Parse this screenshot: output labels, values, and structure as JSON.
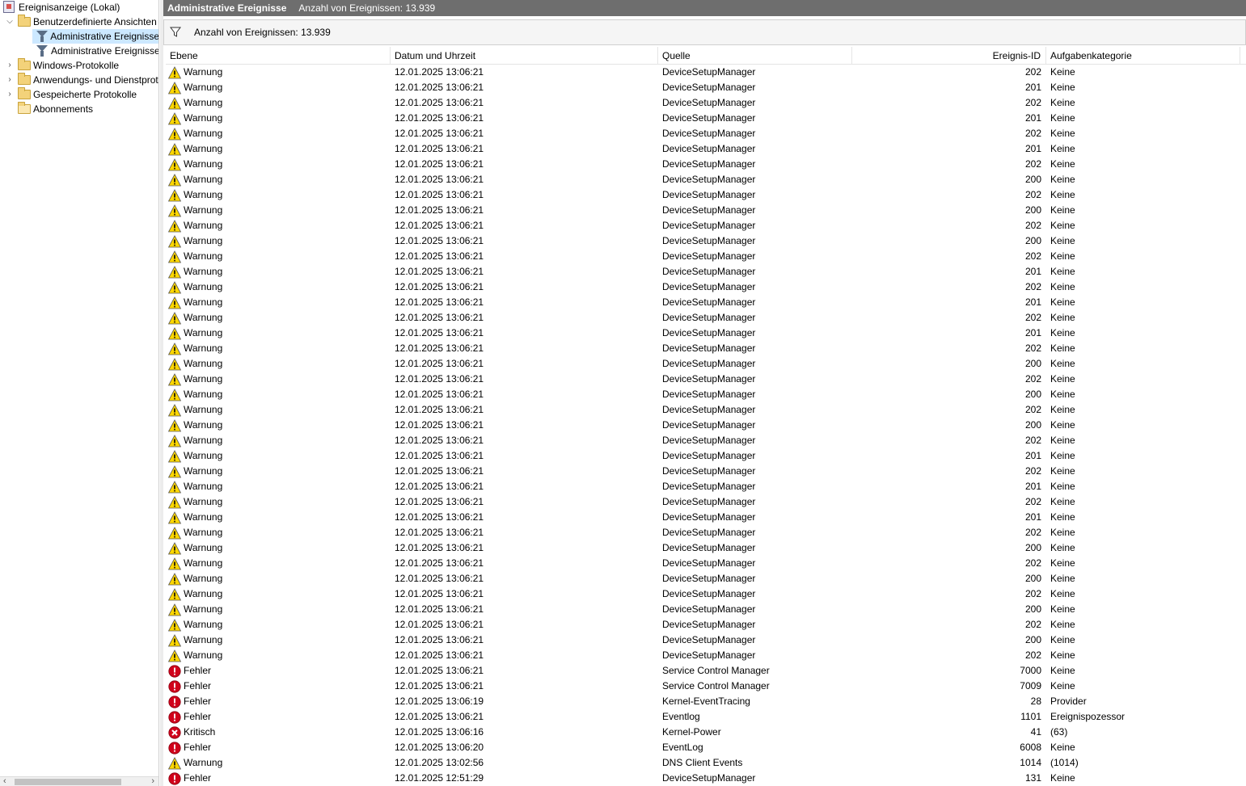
{
  "tree": {
    "root": "Ereignisanzeige (Lokal)",
    "custom_views": "Benutzerdefinierte Ansichten",
    "admin_view_1": "Administrative Ereignisse",
    "admin_view_2": "Administrative Ereignisse",
    "windows_logs": "Windows-Protokolle",
    "app_service_logs": "Anwendungs- und Dienstprotokolle",
    "saved_logs": "Gespeicherte Protokolle",
    "subscriptions": "Abonnements"
  },
  "header": {
    "title": "Administrative Ereignisse",
    "count": "Anzahl von Ereignissen: 13.939"
  },
  "filter": {
    "text": "Anzahl von Ereignissen: 13.939"
  },
  "columns": [
    "Ebene",
    "Datum und Uhrzeit",
    "Quelle",
    "Ereignis-ID",
    "Aufgabenkategorie"
  ],
  "rows": [
    {
      "level": "Warnung",
      "type": "warning",
      "date": "12.01.2025 13:06:21",
      "source": "DeviceSetupManager",
      "id": "202",
      "category": "Keine"
    },
    {
      "level": "Warnung",
      "type": "warning",
      "date": "12.01.2025 13:06:21",
      "source": "DeviceSetupManager",
      "id": "201",
      "category": "Keine"
    },
    {
      "level": "Warnung",
      "type": "warning",
      "date": "12.01.2025 13:06:21",
      "source": "DeviceSetupManager",
      "id": "202",
      "category": "Keine"
    },
    {
      "level": "Warnung",
      "type": "warning",
      "date": "12.01.2025 13:06:21",
      "source": "DeviceSetupManager",
      "id": "201",
      "category": "Keine"
    },
    {
      "level": "Warnung",
      "type": "warning",
      "date": "12.01.2025 13:06:21",
      "source": "DeviceSetupManager",
      "id": "202",
      "category": "Keine"
    },
    {
      "level": "Warnung",
      "type": "warning",
      "date": "12.01.2025 13:06:21",
      "source": "DeviceSetupManager",
      "id": "201",
      "category": "Keine"
    },
    {
      "level": "Warnung",
      "type": "warning",
      "date": "12.01.2025 13:06:21",
      "source": "DeviceSetupManager",
      "id": "202",
      "category": "Keine"
    },
    {
      "level": "Warnung",
      "type": "warning",
      "date": "12.01.2025 13:06:21",
      "source": "DeviceSetupManager",
      "id": "200",
      "category": "Keine"
    },
    {
      "level": "Warnung",
      "type": "warning",
      "date": "12.01.2025 13:06:21",
      "source": "DeviceSetupManager",
      "id": "202",
      "category": "Keine"
    },
    {
      "level": "Warnung",
      "type": "warning",
      "date": "12.01.2025 13:06:21",
      "source": "DeviceSetupManager",
      "id": "200",
      "category": "Keine"
    },
    {
      "level": "Warnung",
      "type": "warning",
      "date": "12.01.2025 13:06:21",
      "source": "DeviceSetupManager",
      "id": "202",
      "category": "Keine"
    },
    {
      "level": "Warnung",
      "type": "warning",
      "date": "12.01.2025 13:06:21",
      "source": "DeviceSetupManager",
      "id": "200",
      "category": "Keine"
    },
    {
      "level": "Warnung",
      "type": "warning",
      "date": "12.01.2025 13:06:21",
      "source": "DeviceSetupManager",
      "id": "202",
      "category": "Keine"
    },
    {
      "level": "Warnung",
      "type": "warning",
      "date": "12.01.2025 13:06:21",
      "source": "DeviceSetupManager",
      "id": "201",
      "category": "Keine"
    },
    {
      "level": "Warnung",
      "type": "warning",
      "date": "12.01.2025 13:06:21",
      "source": "DeviceSetupManager",
      "id": "202",
      "category": "Keine"
    },
    {
      "level": "Warnung",
      "type": "warning",
      "date": "12.01.2025 13:06:21",
      "source": "DeviceSetupManager",
      "id": "201",
      "category": "Keine"
    },
    {
      "level": "Warnung",
      "type": "warning",
      "date": "12.01.2025 13:06:21",
      "source": "DeviceSetupManager",
      "id": "202",
      "category": "Keine"
    },
    {
      "level": "Warnung",
      "type": "warning",
      "date": "12.01.2025 13:06:21",
      "source": "DeviceSetupManager",
      "id": "201",
      "category": "Keine"
    },
    {
      "level": "Warnung",
      "type": "warning",
      "date": "12.01.2025 13:06:21",
      "source": "DeviceSetupManager",
      "id": "202",
      "category": "Keine"
    },
    {
      "level": "Warnung",
      "type": "warning",
      "date": "12.01.2025 13:06:21",
      "source": "DeviceSetupManager",
      "id": "200",
      "category": "Keine"
    },
    {
      "level": "Warnung",
      "type": "warning",
      "date": "12.01.2025 13:06:21",
      "source": "DeviceSetupManager",
      "id": "202",
      "category": "Keine"
    },
    {
      "level": "Warnung",
      "type": "warning",
      "date": "12.01.2025 13:06:21",
      "source": "DeviceSetupManager",
      "id": "200",
      "category": "Keine"
    },
    {
      "level": "Warnung",
      "type": "warning",
      "date": "12.01.2025 13:06:21",
      "source": "DeviceSetupManager",
      "id": "202",
      "category": "Keine"
    },
    {
      "level": "Warnung",
      "type": "warning",
      "date": "12.01.2025 13:06:21",
      "source": "DeviceSetupManager",
      "id": "200",
      "category": "Keine"
    },
    {
      "level": "Warnung",
      "type": "warning",
      "date": "12.01.2025 13:06:21",
      "source": "DeviceSetupManager",
      "id": "202",
      "category": "Keine"
    },
    {
      "level": "Warnung",
      "type": "warning",
      "date": "12.01.2025 13:06:21",
      "source": "DeviceSetupManager",
      "id": "201",
      "category": "Keine"
    },
    {
      "level": "Warnung",
      "type": "warning",
      "date": "12.01.2025 13:06:21",
      "source": "DeviceSetupManager",
      "id": "202",
      "category": "Keine"
    },
    {
      "level": "Warnung",
      "type": "warning",
      "date": "12.01.2025 13:06:21",
      "source": "DeviceSetupManager",
      "id": "201",
      "category": "Keine"
    },
    {
      "level": "Warnung",
      "type": "warning",
      "date": "12.01.2025 13:06:21",
      "source": "DeviceSetupManager",
      "id": "202",
      "category": "Keine"
    },
    {
      "level": "Warnung",
      "type": "warning",
      "date": "12.01.2025 13:06:21",
      "source": "DeviceSetupManager",
      "id": "201",
      "category": "Keine"
    },
    {
      "level": "Warnung",
      "type": "warning",
      "date": "12.01.2025 13:06:21",
      "source": "DeviceSetupManager",
      "id": "202",
      "category": "Keine"
    },
    {
      "level": "Warnung",
      "type": "warning",
      "date": "12.01.2025 13:06:21",
      "source": "DeviceSetupManager",
      "id": "200",
      "category": "Keine"
    },
    {
      "level": "Warnung",
      "type": "warning",
      "date": "12.01.2025 13:06:21",
      "source": "DeviceSetupManager",
      "id": "202",
      "category": "Keine"
    },
    {
      "level": "Warnung",
      "type": "warning",
      "date": "12.01.2025 13:06:21",
      "source": "DeviceSetupManager",
      "id": "200",
      "category": "Keine"
    },
    {
      "level": "Warnung",
      "type": "warning",
      "date": "12.01.2025 13:06:21",
      "source": "DeviceSetupManager",
      "id": "202",
      "category": "Keine"
    },
    {
      "level": "Warnung",
      "type": "warning",
      "date": "12.01.2025 13:06:21",
      "source": "DeviceSetupManager",
      "id": "200",
      "category": "Keine"
    },
    {
      "level": "Warnung",
      "type": "warning",
      "date": "12.01.2025 13:06:21",
      "source": "DeviceSetupManager",
      "id": "202",
      "category": "Keine"
    },
    {
      "level": "Warnung",
      "type": "warning",
      "date": "12.01.2025 13:06:21",
      "source": "DeviceSetupManager",
      "id": "200",
      "category": "Keine"
    },
    {
      "level": "Warnung",
      "type": "warning",
      "date": "12.01.2025 13:06:21",
      "source": "DeviceSetupManager",
      "id": "202",
      "category": "Keine"
    },
    {
      "level": "Fehler",
      "type": "error",
      "date": "12.01.2025 13:06:21",
      "source": "Service Control Manager",
      "id": "7000",
      "category": "Keine"
    },
    {
      "level": "Fehler",
      "type": "error",
      "date": "12.01.2025 13:06:21",
      "source": "Service Control Manager",
      "id": "7009",
      "category": "Keine"
    },
    {
      "level": "Fehler",
      "type": "error",
      "date": "12.01.2025 13:06:19",
      "source": "Kernel-EventTracing",
      "id": "28",
      "category": "Provider"
    },
    {
      "level": "Fehler",
      "type": "error",
      "date": "12.01.2025 13:06:21",
      "source": "Eventlog",
      "id": "1101",
      "category": "Ereignispozessor"
    },
    {
      "level": "Kritisch",
      "type": "critical",
      "date": "12.01.2025 13:06:16",
      "source": "Kernel-Power",
      "id": "41",
      "category": "(63)"
    },
    {
      "level": "Fehler",
      "type": "error",
      "date": "12.01.2025 13:06:20",
      "source": "EventLog",
      "id": "6008",
      "category": "Keine"
    },
    {
      "level": "Warnung",
      "type": "warning",
      "date": "12.01.2025 13:02:56",
      "source": "DNS Client Events",
      "id": "1014",
      "category": "(1014)"
    },
    {
      "level": "Fehler",
      "type": "error",
      "date": "12.01.2025 12:51:29",
      "source": "DeviceSetupManager",
      "id": "131",
      "category": "Keine"
    }
  ]
}
